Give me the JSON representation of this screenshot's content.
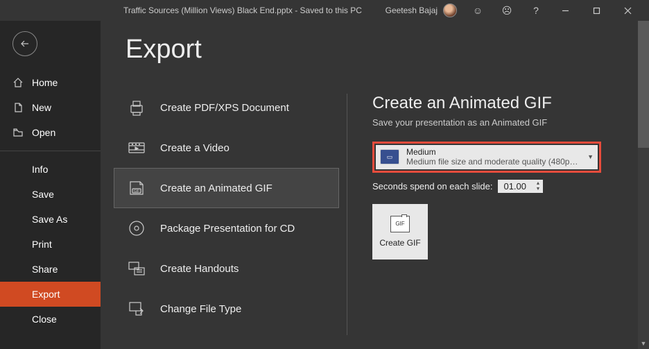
{
  "titlebar": {
    "title": "Traffic Sources (Million Views) Black End.pptx  -  Saved to this PC",
    "user": "Geetesh Bajaj"
  },
  "sidebar": {
    "home": "Home",
    "new": "New",
    "open": "Open",
    "info": "Info",
    "save": "Save",
    "saveas": "Save As",
    "print": "Print",
    "share": "Share",
    "export": "Export",
    "close": "Close"
  },
  "page": {
    "title": "Export"
  },
  "exportOptions": {
    "pdf": "Create PDF/XPS Document",
    "video": "Create a Video",
    "gif": "Create an Animated GIF",
    "package": "Package Presentation for CD",
    "handouts": "Create Handouts",
    "filetype": "Change File Type"
  },
  "right": {
    "title": "Create an Animated GIF",
    "subtitle": "Save your presentation as an Animated GIF",
    "quality": {
      "label": "Medium",
      "desc": "Medium file size and moderate quality (480p at..."
    },
    "secondsLabel": "Seconds spend on each slide:",
    "secondsValue": "01.00",
    "createBtn": "Create GIF",
    "gifBadge": "GIF"
  }
}
